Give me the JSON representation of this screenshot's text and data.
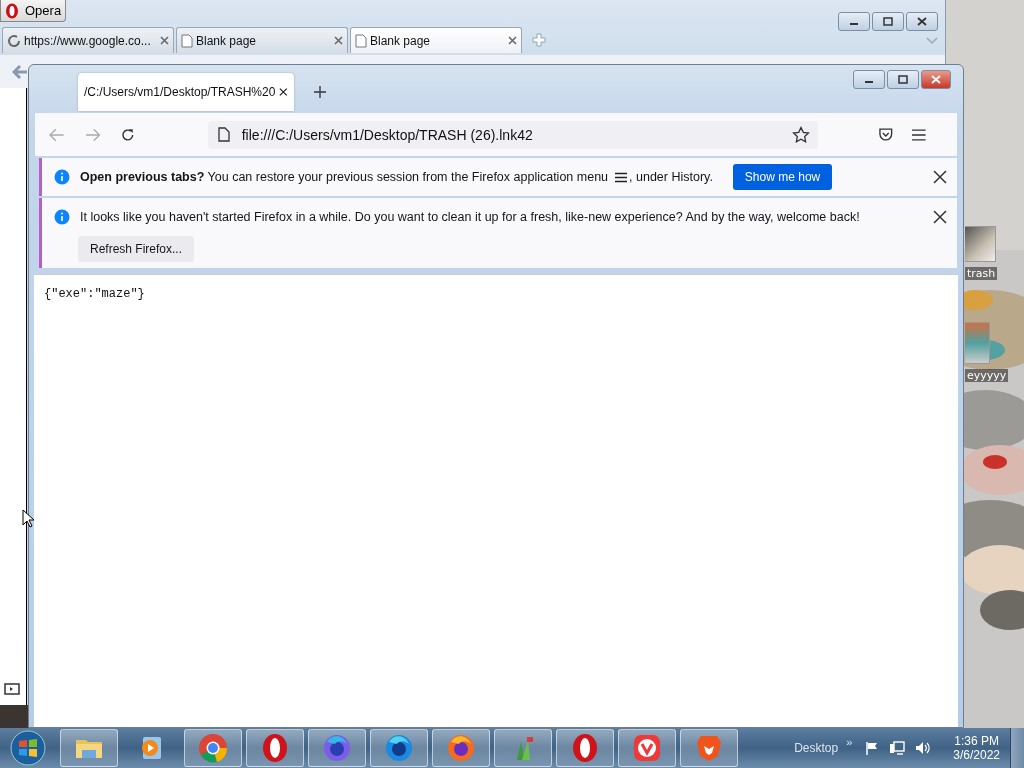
{
  "desktop_icons": [
    {
      "label": "trash"
    },
    {
      "label": "eyyyyy"
    }
  ],
  "opera_window": {
    "title": "Opera",
    "tabs": [
      {
        "label": "https://www.google.co...",
        "kind": "loading",
        "selected": false
      },
      {
        "label": "Blank page",
        "kind": "page",
        "selected": false
      },
      {
        "label": "Blank page",
        "kind": "page",
        "selected": true
      }
    ]
  },
  "firefox_window": {
    "tab": {
      "label": "/C:/Users/vm1/Desktop/TRASH%20",
      "selected": true
    },
    "url": "file:///C:/Users/vm1/Desktop/TRASH (26).lnk42",
    "notifications": [
      {
        "text": "**Open previous tabs?** You can restore your previous session from the Firefox application menu",
        "text_after": ", under History.",
        "button": "Show me how",
        "kind": "primary"
      },
      {
        "text": "It looks like you haven't started Firefox in a while. Do you want to clean it up for a fresh, like-new experience? And by the way, welcome back!",
        "button": "Refresh Firefox...",
        "kind": "secondary"
      }
    ],
    "content": "{\"exe\":\"maze\"}"
  },
  "taskbar": {
    "apps": [
      {
        "kind": "explorer"
      },
      {
        "kind": "media"
      },
      {
        "kind": "chrome"
      },
      {
        "kind": "opera"
      },
      {
        "kind": "firefox-purple"
      },
      {
        "kind": "firefox-blue"
      },
      {
        "kind": "firefox"
      },
      {
        "kind": "green"
      },
      {
        "kind": "opera"
      },
      {
        "kind": "vivaldi"
      },
      {
        "kind": "brave"
      }
    ],
    "desktop_label": "Desktop",
    "overflow": "»",
    "time": "1:36 PM",
    "date": "3/6/2022"
  }
}
